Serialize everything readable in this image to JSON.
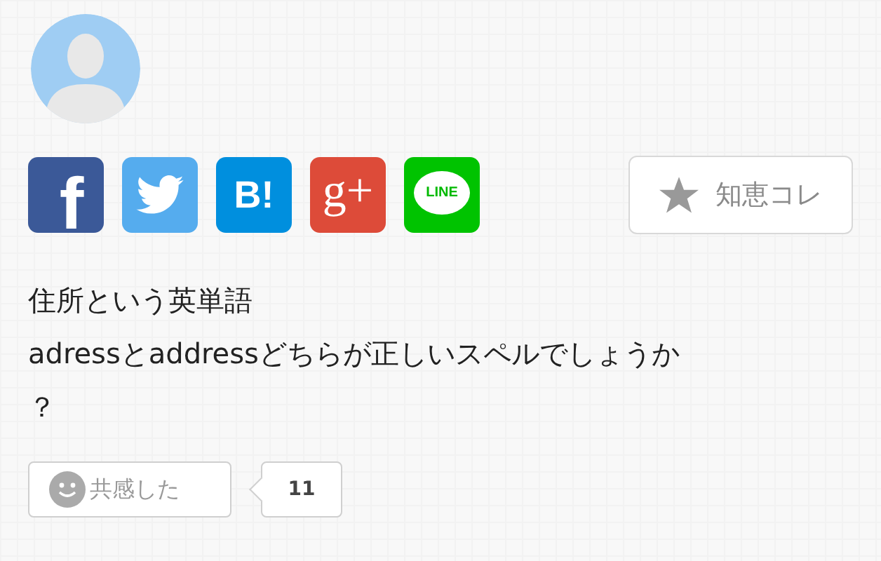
{
  "share_buttons": [
    {
      "kind": "facebook",
      "label": "f"
    },
    {
      "kind": "twitter"
    },
    {
      "kind": "hatena",
      "label": "B!"
    },
    {
      "kind": "google",
      "label": "g+"
    },
    {
      "kind": "line",
      "label": "LINE"
    }
  ],
  "bookmark_button": {
    "label": "知恵コレ"
  },
  "question": {
    "lines": [
      "住所という英単語",
      "adressとaddressどちらが正しいスペルでしょうか",
      "？"
    ]
  },
  "empathy": {
    "label": "共感した",
    "count": "11"
  }
}
